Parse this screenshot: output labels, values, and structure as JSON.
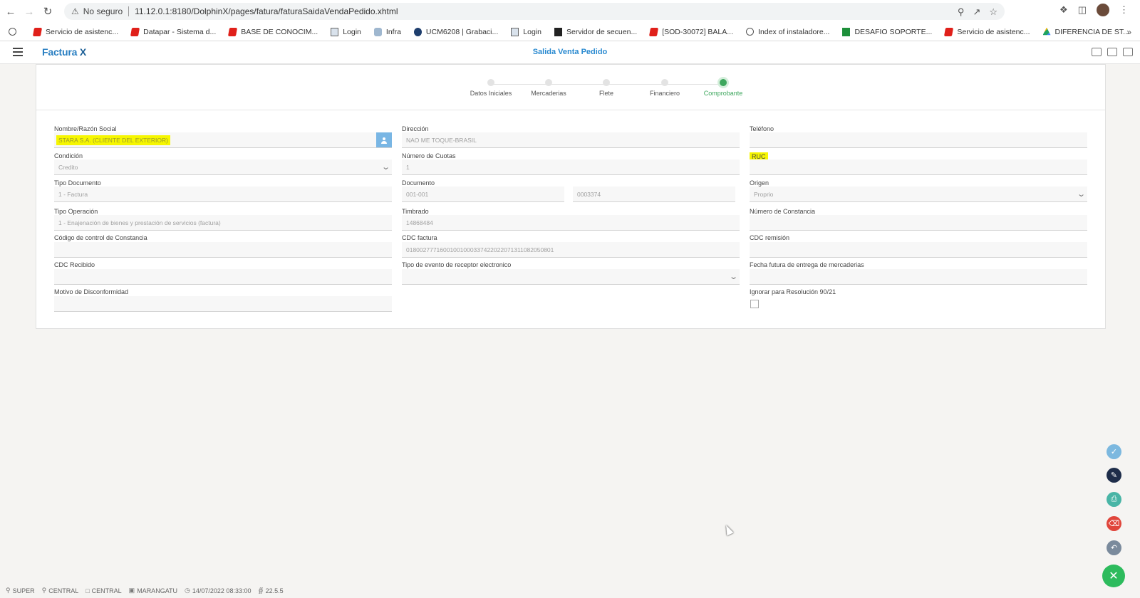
{
  "browser": {
    "security_label": "No seguro",
    "url": "11.12.0.1:8180/DolphinX/pages/fatura/faturaSaidaVendaPedido.xhtml",
    "bookmarks": [
      {
        "label": "Servicio de asistenc...",
        "icon": "red-logo-icon"
      },
      {
        "label": "Datapar - Sistema d...",
        "icon": "red-logo-icon"
      },
      {
        "label": "BASE DE CONOCIM...",
        "icon": "red-logo-icon"
      },
      {
        "label": "Login",
        "icon": "page-icon"
      },
      {
        "label": "Infra",
        "icon": "infra-icon"
      },
      {
        "label": "UCM6208 | Grabaci...",
        "icon": "ucm-icon"
      },
      {
        "label": "Login",
        "icon": "page-icon"
      },
      {
        "label": "Servidor de secuen...",
        "icon": "terminal-icon"
      },
      {
        "label": "[SOD-30072] BALA...",
        "icon": "red-logo-icon"
      },
      {
        "label": "Index of instaladore...",
        "icon": "globe-icon"
      },
      {
        "label": "DESAFIO SOPORTE...",
        "icon": "sheets-icon"
      },
      {
        "label": "Servicio de asistenc...",
        "icon": "red-logo-icon"
      },
      {
        "label": "DIFERENCIA DE ST...",
        "icon": "drive-icon"
      }
    ]
  },
  "app": {
    "logo": "Factura",
    "logo_x": "X",
    "title": "Salida Venta Pedido"
  },
  "steps": [
    {
      "label": "Datos Iniciales",
      "active": false
    },
    {
      "label": "Mercaderias",
      "active": false
    },
    {
      "label": "Flete",
      "active": false
    },
    {
      "label": "Financiero",
      "active": false
    },
    {
      "label": "Comprobante",
      "active": true
    }
  ],
  "form": {
    "nombre": {
      "label": "Nombre/Razón Social",
      "value": "STARA S.A. (CLIENTE DEL EXTERIOR)"
    },
    "direccion": {
      "label": "Dirección",
      "value": "NAO ME TOQUE-BRASIL"
    },
    "telefono": {
      "label": "Teléfono",
      "value": ""
    },
    "condicion": {
      "label": "Condición",
      "value": "Credito"
    },
    "numero_cuotas": {
      "label": "Número de Cuotas",
      "value": "1"
    },
    "ruc": {
      "label": "RUC",
      "value": ""
    },
    "tipo_documento": {
      "label": "Tipo Documento",
      "value": "1 - Factura"
    },
    "documento": {
      "label": "Documento",
      "value1": "001-001",
      "value2": "0003374"
    },
    "origen": {
      "label": "Origen",
      "value": "Proprio"
    },
    "tipo_operacion": {
      "label": "Tipo Operación",
      "value": "1 - Enajenación de bienes y prestación de servicios (factura)"
    },
    "timbrado": {
      "label": "Timbrado",
      "value": "14868484"
    },
    "numero_constancia": {
      "label": "Número de Constancia",
      "value": ""
    },
    "codigo_control": {
      "label": "Código de control de Constancia",
      "value": ""
    },
    "cdc_factura": {
      "label": "CDC factura",
      "value": "01800277716001001000337422022071311082050801"
    },
    "cdc_remision": {
      "label": "CDC remisión",
      "value": ""
    },
    "cdc_recibido": {
      "label": "CDC Recibido",
      "value": ""
    },
    "tipo_evento": {
      "label": "Tipo de evento de receptor electronico",
      "value": ""
    },
    "fecha_futura": {
      "label": "Fecha futura de entrega de mercaderias",
      "value": ""
    },
    "motivo": {
      "label": "Motivo de Disconformidad",
      "value": ""
    },
    "ignorar": {
      "label": "Ignorar para Resolución 90/21",
      "checked": false
    }
  },
  "status": {
    "user": "SUPER",
    "location": "CENTRAL",
    "branch": "CENTRAL",
    "company": "MARANGATU",
    "datetime": "14/07/2022 08:33:00",
    "version": "22.5.5"
  },
  "colors": {
    "accent": "#2a8ad0",
    "active_step": "#3ea75e",
    "highlight": "#f6f600"
  }
}
